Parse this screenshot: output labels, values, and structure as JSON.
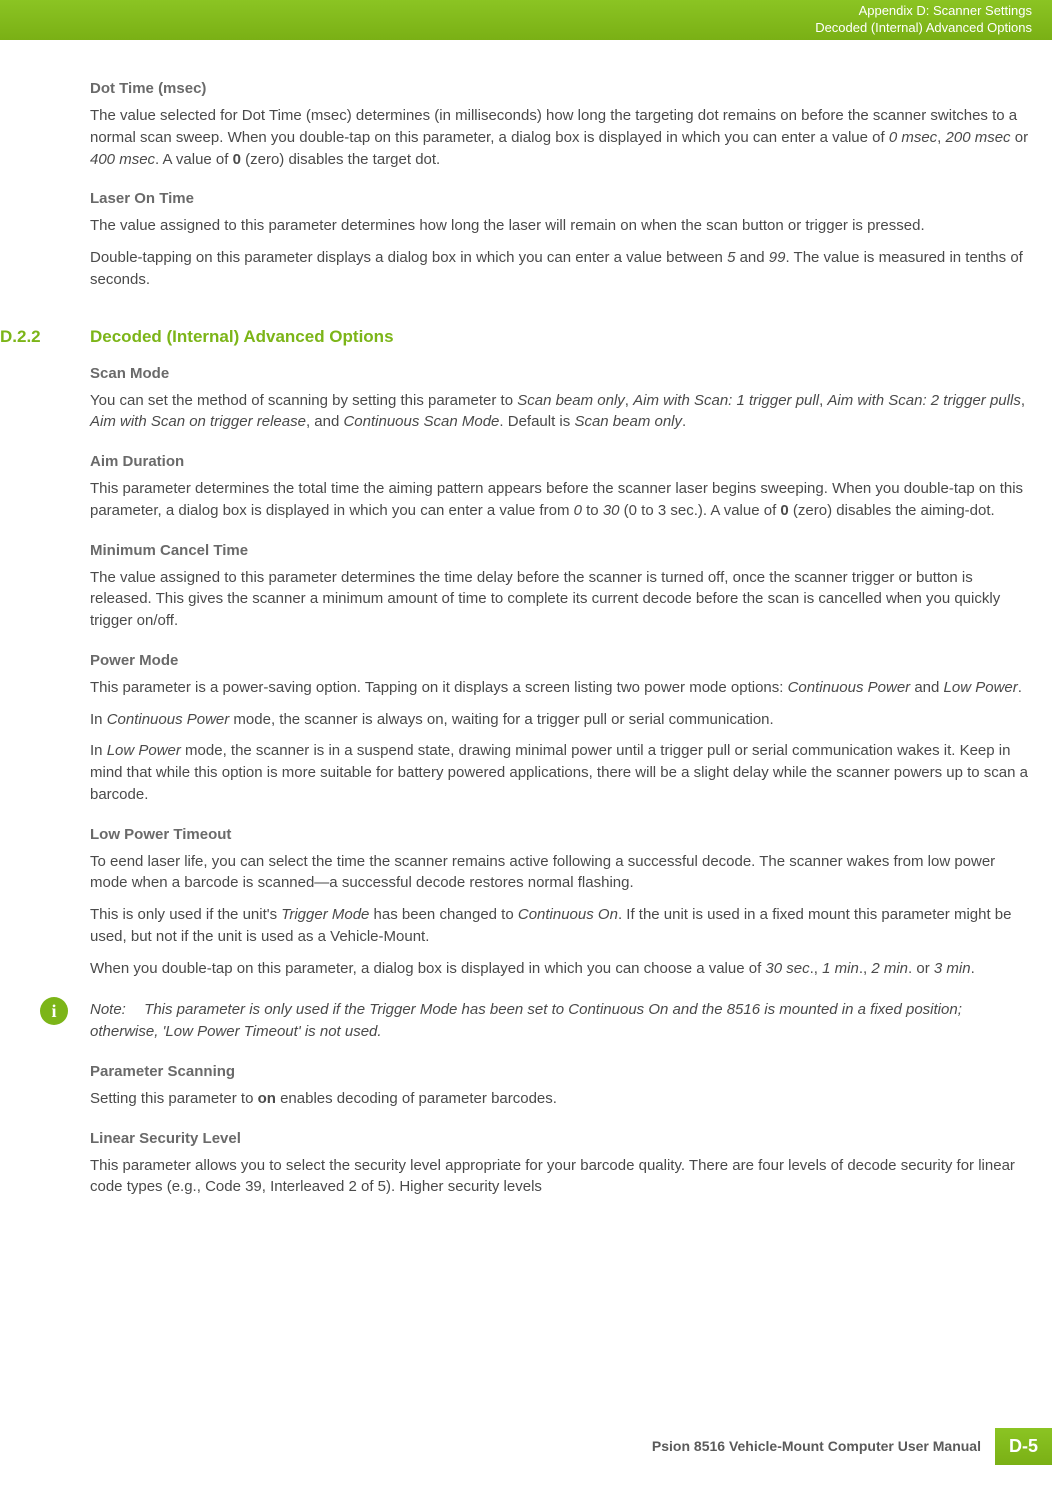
{
  "header": {
    "line1": "Appendix D: Scanner Settings",
    "line2": "Decoded (Internal) Advanced Options"
  },
  "sections": {
    "dotTime": {
      "heading": "Dot Time (msec)",
      "body": "The value selected for Dot Time (msec) determines (in milliseconds) how long the targeting dot remains on before the scanner switches to a normal scan sweep. When you double-tap on this parameter, a dialog box is displayed in which you can enter a value of 0 msec, 200 msec or 400 msec. A value of 0 (zero) disables the target dot."
    },
    "laserOn": {
      "heading": "Laser On Time",
      "p1": "The value assigned to this parameter determines how long the laser will remain on when the scan button or trigger is pressed.",
      "p2": "Double-tapping on this parameter displays a dialog box in which you can enter a value between 5 and 99. The value is measured in tenths of seconds."
    },
    "d22": {
      "number": "D.2.2",
      "title": "Decoded (Internal) Advanced Options"
    },
    "scanMode": {
      "heading": " Scan Mode",
      "body": "You can set the method of scanning by setting this parameter to Scan beam only, Aim with Scan: 1 trigger pull, Aim with Scan: 2 trigger pulls, Aim with Scan on trigger release, and Continuous Scan Mode. Default is Scan beam only."
    },
    "aimDuration": {
      "heading": "Aim Duration",
      "body": "This parameter determines the total time the aiming pattern appears before the scanner laser begins sweeping. When you double-tap on this parameter, a dialog box is displayed in which you can enter a value from 0 to 30 (0 to 3 sec.). A value of 0 (zero) disables the aiming-dot."
    },
    "minCancel": {
      "heading": "Minimum Cancel Time",
      "body": "The value assigned to this parameter determines the time delay before the scanner is turned off, once the scanner trigger or button is released. This gives the scanner a minimum amount of time to complete its current decode before the scan is cancelled when you quickly trigger on/off."
    },
    "powerMode": {
      "heading": "Power Mode",
      "p1": "This parameter is a power-saving option. Tapping on it displays a screen listing two power mode options: Continuous Power and Low Power.",
      "p2": "In Continuous Power mode, the scanner is always on, waiting for a trigger pull or serial communication.",
      "p3": "In Low Power mode, the scanner is in a suspend state, drawing minimal power until a trigger pull or serial communication wakes it. Keep in mind that while this option is more suitable for battery powered applications, there will be a slight delay while the scanner powers up to scan a barcode."
    },
    "lowPowerTimeout": {
      "heading": "Low Power Timeout",
      "p1": "To eend laser life, you can select the time the scanner remains active following a successful decode. The scanner wakes from low power mode when a barcode is scanned—a successful decode restores normal flashing.",
      "p2": "This is only used if the unit's Trigger Mode has been changed to Continuous On. If the unit is used in a fixed mount this parameter might be used, but not if the unit is used as a Vehicle-Mount.",
      "p3": "When you double-tap on this parameter, a dialog box is displayed in which you can choose a value of 30 sec., 1 min., 2 min. or 3 min."
    },
    "note": {
      "label": "Note:",
      "text": "This parameter is only used if the Trigger Mode has been set to Continuous On and the 8516 is mounted in a fixed position; otherwise, 'Low Power Timeout' is not used."
    },
    "paramScanning": {
      "heading": "Parameter Scanning",
      "body": "Setting this parameter to on enables decoding of parameter barcodes."
    },
    "linearSecurity": {
      "heading": "Linear Security Level",
      "body": "This parameter allows you to select the security level appropriate for your barcode quality. There are four levels of decode security for linear code types (e.g., Code 39, Interleaved 2 of 5). Higher security levels"
    }
  },
  "footer": {
    "title": "Psion 8516 Vehicle-Mount Computer User Manual",
    "page": "D-5"
  }
}
